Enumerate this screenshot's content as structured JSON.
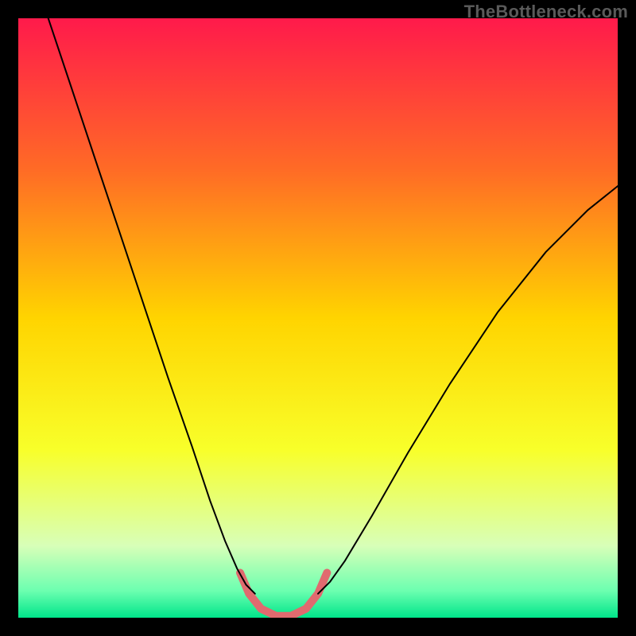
{
  "watermark": "TheBottleneck.com",
  "chart_data": {
    "type": "line",
    "title": "",
    "xlabel": "",
    "ylabel": "",
    "xlim": [
      0,
      1
    ],
    "ylim": [
      0,
      1
    ],
    "background": {
      "type": "vertical-gradient",
      "stops": [
        {
          "offset": 0.0,
          "color": "#ff1a4b"
        },
        {
          "offset": 0.25,
          "color": "#ff6a26"
        },
        {
          "offset": 0.5,
          "color": "#ffd400"
        },
        {
          "offset": 0.72,
          "color": "#f8ff2a"
        },
        {
          "offset": 0.88,
          "color": "#d8ffb8"
        },
        {
          "offset": 0.955,
          "color": "#6cffb0"
        },
        {
          "offset": 1.0,
          "color": "#00e58a"
        }
      ]
    },
    "series": [
      {
        "name": "left-curve",
        "stroke": "#000000",
        "stroke_width": 2,
        "x": [
          0.05,
          0.09,
          0.13,
          0.17,
          0.21,
          0.25,
          0.29,
          0.32,
          0.345,
          0.365,
          0.38,
          0.395
        ],
        "y": [
          1.0,
          0.88,
          0.76,
          0.64,
          0.52,
          0.4,
          0.285,
          0.195,
          0.128,
          0.082,
          0.055,
          0.04
        ]
      },
      {
        "name": "right-curve",
        "stroke": "#000000",
        "stroke_width": 2,
        "x": [
          0.5,
          0.52,
          0.545,
          0.59,
          0.65,
          0.72,
          0.8,
          0.88,
          0.95,
          1.0
        ],
        "y": [
          0.04,
          0.06,
          0.095,
          0.17,
          0.275,
          0.39,
          0.51,
          0.61,
          0.68,
          0.72
        ]
      },
      {
        "name": "highlight-band",
        "stroke": "#e06a6f",
        "stroke_width": 10,
        "x": [
          0.37,
          0.385,
          0.405,
          0.43,
          0.455,
          0.48,
          0.5,
          0.515
        ],
        "y": [
          0.075,
          0.04,
          0.015,
          0.003,
          0.003,
          0.015,
          0.04,
          0.075
        ]
      }
    ],
    "minimum_x": 0.44,
    "minimum_y": 0.0
  }
}
